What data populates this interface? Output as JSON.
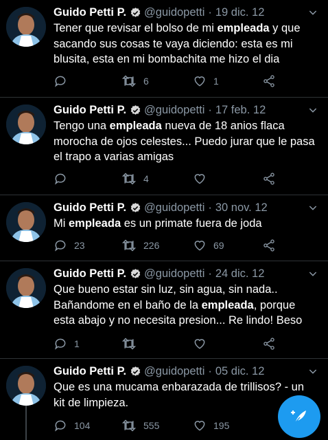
{
  "tweets": [
    {
      "name": "Guido Petti P.",
      "handle": "@guidopetti",
      "date": "19 dic. 12",
      "text_parts": [
        "Tener que revisar el bolso de mi ",
        "empleada",
        " y que sacando sus cosas te vaya diciendo: esta es mi blusita, esta en mi bombachita me hizo el dia"
      ],
      "replies": "",
      "retweets": "6",
      "likes": "1"
    },
    {
      "name": "Guido Petti P.",
      "handle": "@guidopetti",
      "date": "17 feb. 12",
      "text_parts": [
        "Tengo una ",
        "empleada",
        " nueva de 18 anios flaca morocha de ojos celestes... Puedo jurar que le pasa el trapo a varias amigas"
      ],
      "replies": "",
      "retweets": "4",
      "likes": ""
    },
    {
      "name": "Guido Petti P.",
      "handle": "@guidopetti",
      "date": "30 nov. 12",
      "text_parts": [
        "Mi ",
        "empleada",
        " es un primate fuera de joda"
      ],
      "replies": "23",
      "retweets": "226",
      "likes": "69"
    },
    {
      "name": "Guido Petti P.",
      "handle": "@guidopetti",
      "date": "24 dic. 12",
      "text_parts": [
        "Que bueno estar sin luz, sin agua, sin nada.. Bañandome en el baño de la ",
        "empleada",
        ", porque esta abajo y no necesita presion... Re lindo! Beso"
      ],
      "replies": "1",
      "retweets": "",
      "likes": ""
    },
    {
      "name": "Guido Petti P.",
      "handle": "@guidopetti",
      "date": "05 dic. 12",
      "text_parts": [
        "Que es una mucama enbarazada de trillisos? - un kit de limpieza.",
        "",
        ""
      ],
      "replies": "104",
      "retweets": "555",
      "likes": "195"
    }
  ],
  "separator": "·",
  "colors": {
    "background": "#000000",
    "secondary_text": "#8b98a5",
    "accent": "#1d9bf0",
    "divider": "#2f3336"
  },
  "icons": {
    "reply": "speech-bubble-icon",
    "retweet": "retweet-arrows-icon",
    "like": "heart-outline-icon",
    "share": "share-nodes-icon",
    "verified": "verified-badge-icon",
    "caret": "chevron-down-icon",
    "compose": "compose-feather-plus-icon"
  }
}
